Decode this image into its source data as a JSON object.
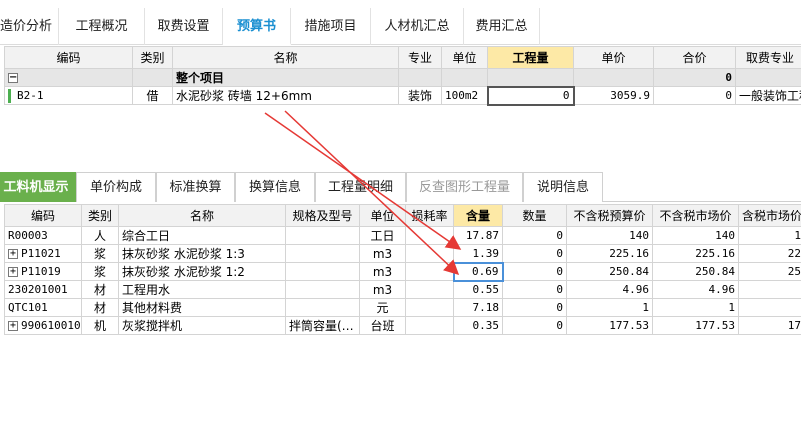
{
  "top_tabs": [
    "造价分析",
    "工程概况",
    "取费设置",
    "预算书",
    "措施项目",
    "人材机汇总",
    "费用汇总"
  ],
  "upper_table": {
    "headers": [
      "编码",
      "类别",
      "名称",
      "专业",
      "单位",
      "工程量",
      "单价",
      "合价",
      "取费专业"
    ],
    "group_row": {
      "expander": "−",
      "name": "整个项目",
      "total": "0"
    },
    "row": {
      "code": "B2-1",
      "type": "借",
      "name": "水泥砂浆 砖墙 12+6mm",
      "major": "装饰",
      "unit": "100m2",
      "qty": "0",
      "price": "3059.9",
      "total": "0",
      "fee": "一般装饰工程"
    }
  },
  "sub_tabs": [
    "工料机显示",
    "单价构成",
    "标准换算",
    "换算信息",
    "工程量明细",
    "反查图形工程量",
    "说明信息"
  ],
  "lower_table": {
    "headers": [
      "编码",
      "类别",
      "名称",
      "规格及型号",
      "单位",
      "损耗率",
      "含量",
      "数量",
      "不含税预算价",
      "不含税市场价",
      "含税市场价"
    ],
    "rows": [
      {
        "exp": "",
        "code": "R00003",
        "type": "人",
        "name": "综合工日",
        "spec": "",
        "unit": "工日",
        "loss": "",
        "content": "17.87",
        "qty": "0",
        "budget": "140",
        "market": "140",
        "taxmarket": "1"
      },
      {
        "exp": "+",
        "code": "P11021",
        "type": "浆",
        "name": "抹灰砂浆 水泥砂浆 1:3",
        "spec": "",
        "unit": "m3",
        "loss": "",
        "content": "1.39",
        "qty": "0",
        "budget": "225.16",
        "market": "225.16",
        "taxmarket": "22"
      },
      {
        "exp": "+",
        "code": "P11019",
        "type": "浆",
        "name": "抹灰砂浆 水泥砂浆 1:2",
        "spec": "",
        "unit": "m3",
        "loss": "",
        "content": "0.69",
        "qty": "0",
        "budget": "250.84",
        "market": "250.84",
        "taxmarket": "25"
      },
      {
        "exp": "",
        "code": "230201001",
        "type": "材",
        "name": "工程用水",
        "spec": "",
        "unit": "m3",
        "loss": "",
        "content": "0.55",
        "qty": "0",
        "budget": "4.96",
        "market": "4.96",
        "taxmarket": ""
      },
      {
        "exp": "",
        "code": "QTC101",
        "type": "材",
        "name": "其他材料费",
        "spec": "",
        "unit": "元",
        "loss": "",
        "content": "7.18",
        "qty": "0",
        "budget": "1",
        "market": "1",
        "taxmarket": ""
      },
      {
        "exp": "+",
        "code": "990610010",
        "type": "机",
        "name": "灰浆搅拌机",
        "spec": "拌筒容量(…",
        "unit": "台班",
        "loss": "",
        "content": "0.35",
        "qty": "0",
        "budget": "177.53",
        "market": "177.53",
        "taxmarket": "17"
      }
    ]
  },
  "colors": {
    "active_tab": "#1a8fd1",
    "sub_active": "#6ab04c",
    "qty_header": "#fde9a6",
    "arrow": "#e53935"
  }
}
